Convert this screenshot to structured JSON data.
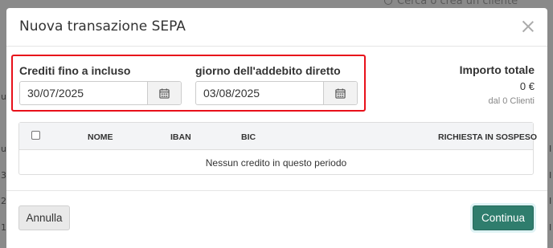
{
  "background": {
    "search_placeholder": "Cerca o crea un cliente",
    "edge_left": [
      "u",
      "u",
      "3",
      "2",
      "1"
    ],
    "edge_right": [
      "I",
      "I",
      "I",
      "I",
      "I"
    ]
  },
  "modal": {
    "title": "Nuova transazione SEPA",
    "credits_label": "Crediti fino a incluso",
    "credits_value": "30/07/2025",
    "debit_label": "giorno dell'addebito diretto",
    "debit_value": "03/08/2025",
    "total_label": "Importo totale",
    "total_value": "0 €",
    "total_sub": "dal 0 Clienti"
  },
  "table": {
    "columns": [
      "NOME",
      "IBAN",
      "BIC",
      "RICHIESTA IN SOSPESO"
    ],
    "empty_message": "Nessun credito in questo periodo"
  },
  "footer": {
    "cancel_label": "Annulla",
    "continue_label": "Continua"
  },
  "colors": {
    "highlight": "#e8101a",
    "primary": "#2f7d6d"
  },
  "icons": {
    "calendar": "calendar-icon",
    "close": "close-icon",
    "search": "search-icon"
  }
}
